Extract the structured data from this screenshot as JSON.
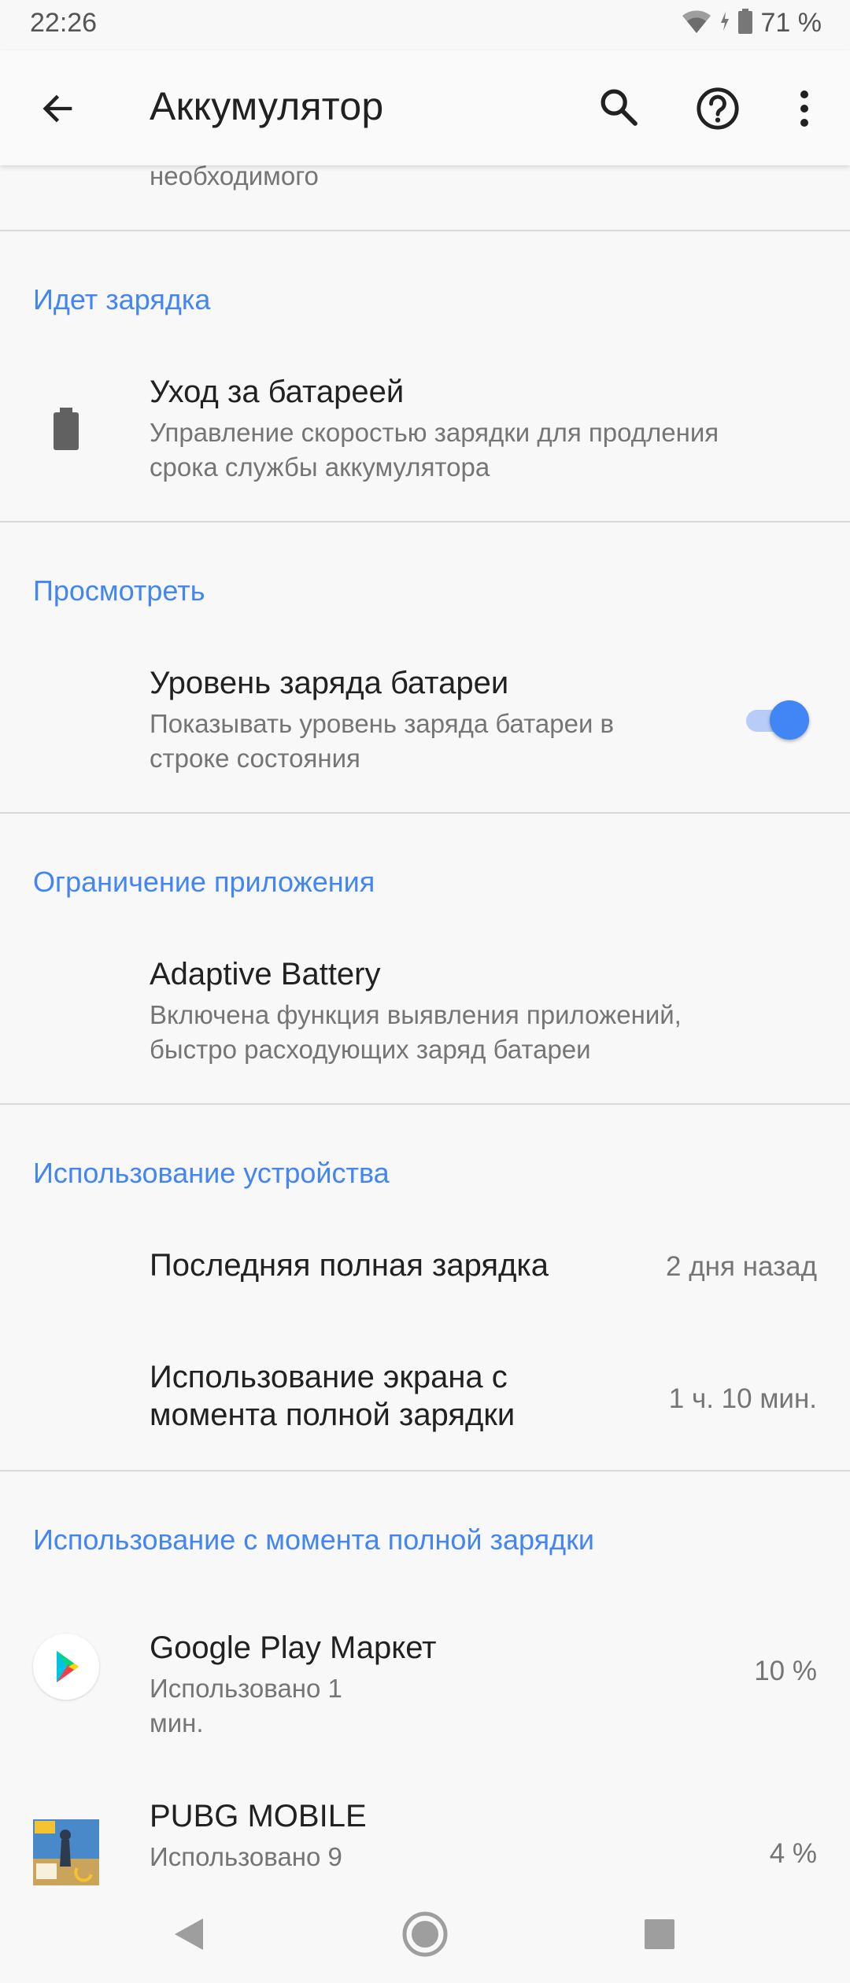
{
  "status": {
    "time": "22:26",
    "battery_text": "71 %",
    "icons": [
      "wifi-icon",
      "battery-icon"
    ]
  },
  "appbar": {
    "title": "Аккумулятор",
    "icons": [
      "back-arrow-icon",
      "search-icon",
      "help-icon",
      "more-vert-icon"
    ]
  },
  "partial_top_text": "необходимого",
  "sections": {
    "charging": {
      "header": "Идет зарядка",
      "item": {
        "title": "Уход за батареей",
        "subtitle_line1": "Управление скоростью зарядки для продления",
        "subtitle_line2": "срока службы аккумулятора",
        "icon": "battery-care-icon"
      }
    },
    "view": {
      "header": "Просмотреть",
      "item": {
        "title": "Уровень заряда батареи",
        "subtitle_line1": "Показывать уровень заряда батареи в",
        "subtitle_line2": "строке состояния",
        "toggle_on": true
      }
    },
    "app_restriction": {
      "header": "Ограничение приложения",
      "item": {
        "title": "Adaptive Battery",
        "subtitle_line1": "Включена функция выявления приложений,",
        "subtitle_line2": "быстро расходующих заряд батареи"
      }
    },
    "device_usage": {
      "header": "Использование устройства",
      "items": [
        {
          "title_line1": "Последняя полная зарядка",
          "title_line2": "",
          "value": "2 дня назад"
        },
        {
          "title_line1": "Использование экрана с",
          "title_line2": "момента полной зарядки",
          "value": "1 ч. 10 мин."
        }
      ]
    },
    "usage_since_full": {
      "header": "Использование с момента полной зарядки",
      "apps": [
        {
          "name": "Google Play Маркет",
          "usage_line1": "Использовано 1",
          "usage_line2": "мин.",
          "percent": "10 %",
          "icon": "google-play-icon"
        },
        {
          "name": "PUBG MOBILE",
          "usage_line1": "Использовано 9",
          "usage_line2": "",
          "percent": "4 %",
          "icon": "pubg-mobile-icon"
        }
      ]
    }
  },
  "navbar": {
    "icons": [
      "nav-back-icon",
      "nav-home-icon",
      "nav-recents-icon"
    ]
  },
  "colors": {
    "accent": "#4285f4",
    "background": "#f8f8f8",
    "divider": "#d9d9d9"
  }
}
